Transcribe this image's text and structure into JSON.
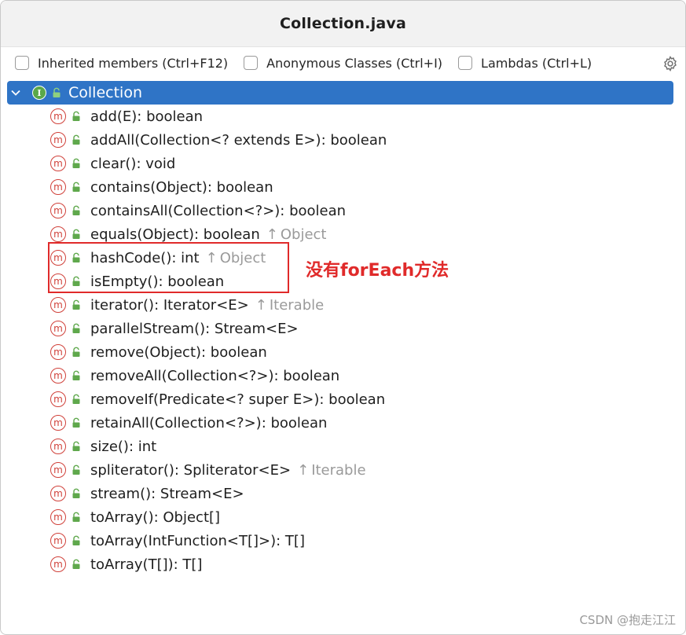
{
  "window": {
    "title": "Collection.java"
  },
  "toolbar": {
    "checkboxes": [
      {
        "label": "Inherited members (Ctrl+F12)",
        "checked": false
      },
      {
        "label": "Anonymous Classes (Ctrl+I)",
        "checked": false
      },
      {
        "label": "Lambdas (Ctrl+L)",
        "checked": false
      }
    ],
    "settings_icon": "gear-icon"
  },
  "tree": {
    "root": {
      "label": "Collection",
      "icon_letter": "I",
      "expanded": true,
      "selected": true
    },
    "members": [
      {
        "signature": "add(E): boolean",
        "inherited_from": ""
      },
      {
        "signature": "addAll(Collection<? extends E>): boolean",
        "inherited_from": ""
      },
      {
        "signature": "clear(): void",
        "inherited_from": ""
      },
      {
        "signature": "contains(Object): boolean",
        "inherited_from": ""
      },
      {
        "signature": "containsAll(Collection<?>): boolean",
        "inherited_from": ""
      },
      {
        "signature": "equals(Object): boolean",
        "inherited_from": "Object"
      },
      {
        "signature": "hashCode(): int",
        "inherited_from": "Object"
      },
      {
        "signature": "isEmpty(): boolean",
        "inherited_from": ""
      },
      {
        "signature": "iterator(): Iterator<E>",
        "inherited_from": "Iterable"
      },
      {
        "signature": "parallelStream(): Stream<E>",
        "inherited_from": ""
      },
      {
        "signature": "remove(Object): boolean",
        "inherited_from": ""
      },
      {
        "signature": "removeAll(Collection<?>): boolean",
        "inherited_from": ""
      },
      {
        "signature": "removeIf(Predicate<? super E>): boolean",
        "inherited_from": ""
      },
      {
        "signature": "retainAll(Collection<?>): boolean",
        "inherited_from": ""
      },
      {
        "signature": "size(): int",
        "inherited_from": ""
      },
      {
        "signature": "spliterator(): Spliterator<E>",
        "inherited_from": "Iterable"
      },
      {
        "signature": "stream(): Stream<E>",
        "inherited_from": ""
      },
      {
        "signature": "toArray(): Object[]",
        "inherited_from": ""
      },
      {
        "signature": "toArray(IntFunction<T[]>): T[]",
        "inherited_from": ""
      },
      {
        "signature": "toArray(T[]): T[]",
        "inherited_from": ""
      }
    ],
    "method_icon_letter": "m"
  },
  "annotation": {
    "text": "没有forEach方法",
    "color": "#e02a2a"
  },
  "watermark": "CSDN @抱走江江",
  "colors": {
    "selection": "#2f74c6",
    "method_icon": "#d0413a",
    "interface_icon": "#5aa84a",
    "lock_icon": "#5fa84c",
    "inherited_text": "#9a9a9a"
  }
}
